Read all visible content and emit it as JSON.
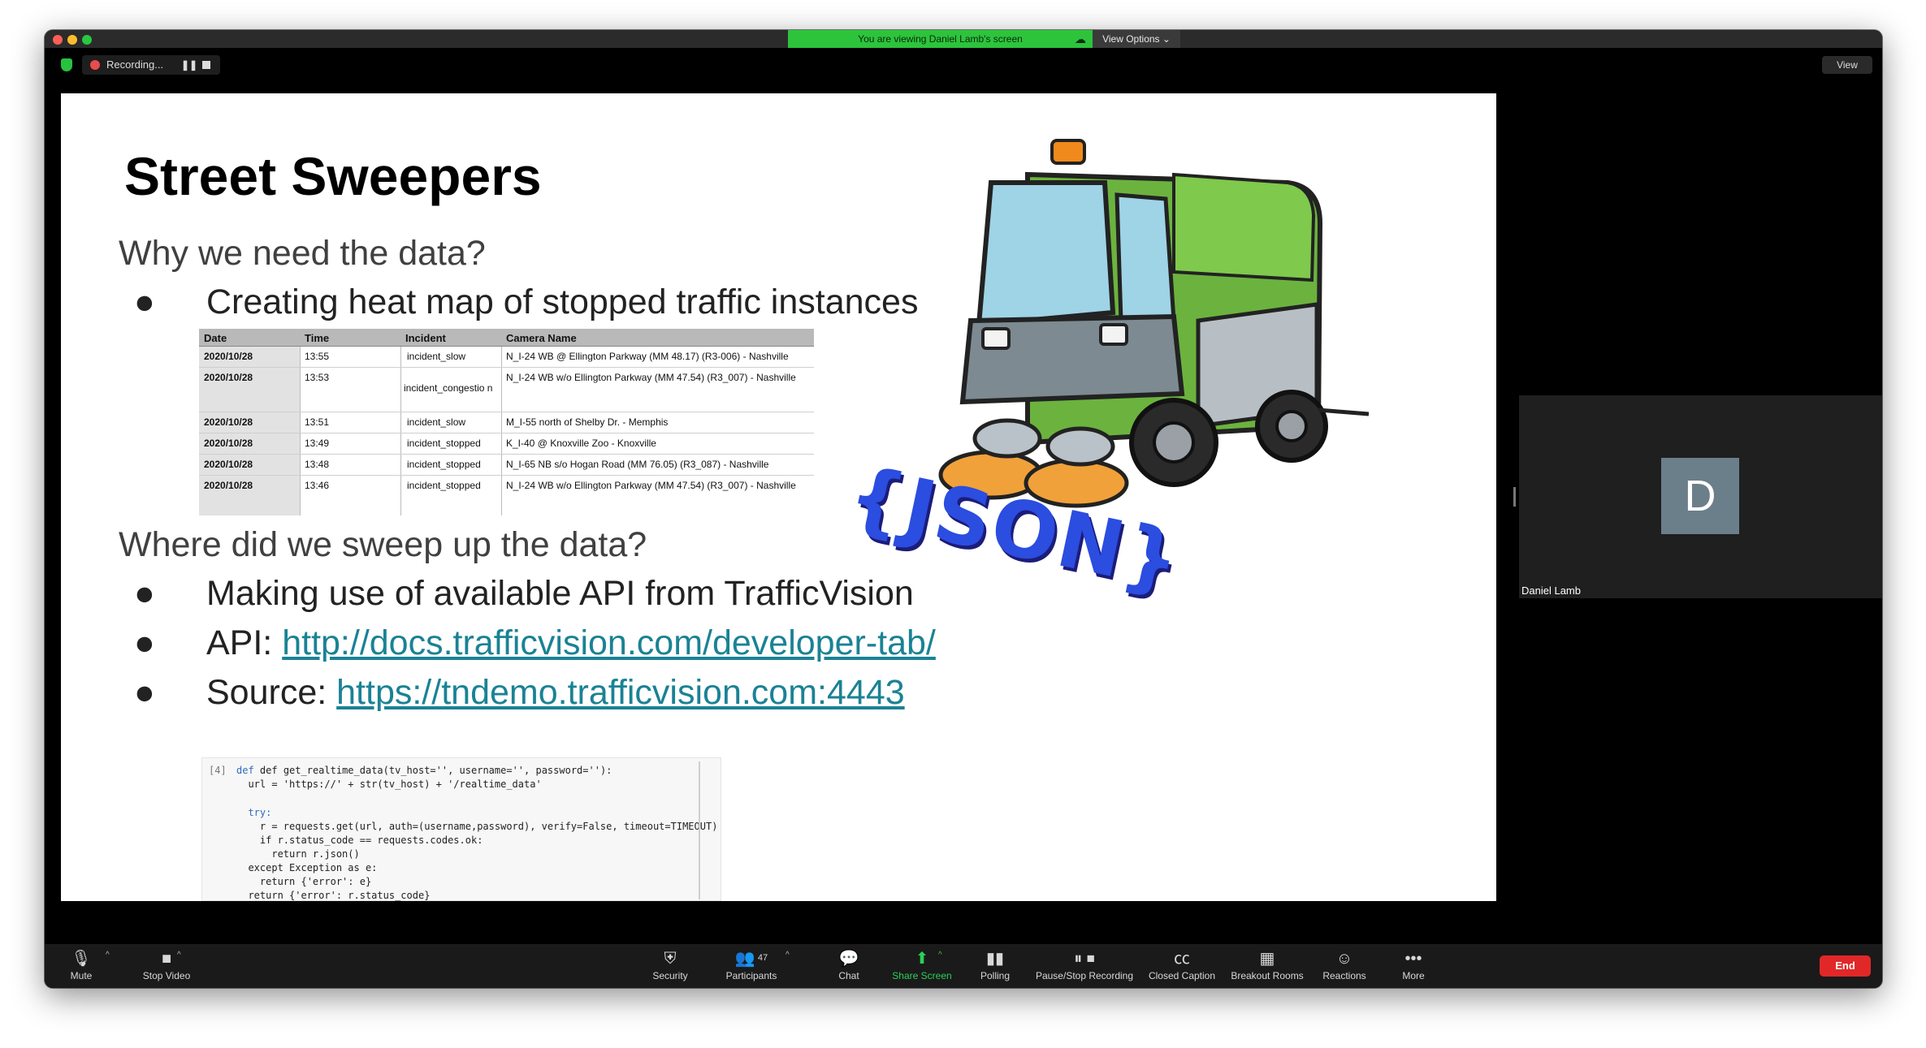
{
  "banner": {
    "viewing_text": "You are viewing Daniel Lamb's screen",
    "view_options": "View Options ⌄"
  },
  "recording": {
    "label": "Recording..."
  },
  "view_button": "View",
  "slide": {
    "title": "Street Sweepers",
    "q1": "Why we need the data?",
    "b1": "Creating heat map of stopped traffic instances",
    "q2": "Where did we sweep up the data?",
    "b2": "Making use of available API from TrafficVision",
    "b3_prefix": "API: ",
    "b3_link": "http://docs.trafficvision.com/developer-tab/",
    "b4_prefix": "Source: ",
    "b4_link": "https://tndemo.trafficvision.com:4443",
    "bullet_glyph": "●",
    "json_label": "{JSON}"
  },
  "table": {
    "headers": [
      "Date",
      "Time",
      "Incident",
      "Camera Name"
    ],
    "rows": [
      [
        "2020/10/28",
        "13:55",
        "incident_slow",
        "N_I-24 WB @ Ellington Parkway (MM 48.17) (R3-006) - Nashville"
      ],
      [
        "2020/10/28",
        "13:53",
        "incident_congestio n",
        "N_I-24 WB w/o Ellington Parkway (MM 47.54) (R3_007) - Nashville"
      ],
      [
        "2020/10/28",
        "13:51",
        "incident_slow",
        "M_I-55 north of Shelby Dr. - Memphis"
      ],
      [
        "2020/10/28",
        "13:49",
        "incident_stopped",
        "K_I-40 @ Knoxville Zoo - Knoxville"
      ],
      [
        "2020/10/28",
        "13:48",
        "incident_stopped",
        "N_I-65 NB s/o Hogan Road (MM 76.05) (R3_087) - Nashville"
      ],
      [
        "2020/10/28",
        "13:46",
        "incident_stopped",
        "N_I-24 WB w/o Ellington Parkway (MM 47.54) (R3_007) - Nashville"
      ]
    ]
  },
  "code": {
    "cell_label": "[4]",
    "lines": [
      "def get_realtime_data(tv_host='', username='', password=''):",
      "  url = 'https://' + str(tv_host) + '/realtime_data'",
      "",
      "  try:",
      "    r = requests.get(url, auth=(username,password), verify=False, timeout=TIMEOUT)",
      "    if r.status_code == requests.codes.ok:",
      "      return r.json()",
      "  except Exception as e:",
      "    return {'error': e}",
      "",
      "  return {'error': r.status_code}"
    ]
  },
  "participant": {
    "initial": "D",
    "name": "Daniel Lamb"
  },
  "toolbar": {
    "mute": "Mute",
    "stop_video": "Stop Video",
    "security": "Security",
    "participants": "Participants",
    "participants_count": "47",
    "chat": "Chat",
    "share_screen": "Share Screen",
    "polling": "Polling",
    "pause_stop_recording": "Pause/Stop Recording",
    "closed_caption": "Closed Caption",
    "breakout_rooms": "Breakout Rooms",
    "reactions": "Reactions",
    "more": "More",
    "end": "End"
  },
  "colors": {
    "link": "#1a8295",
    "share_green": "#2bd05a",
    "end_red": "#e02828",
    "json_blue": "#2b4de0"
  }
}
